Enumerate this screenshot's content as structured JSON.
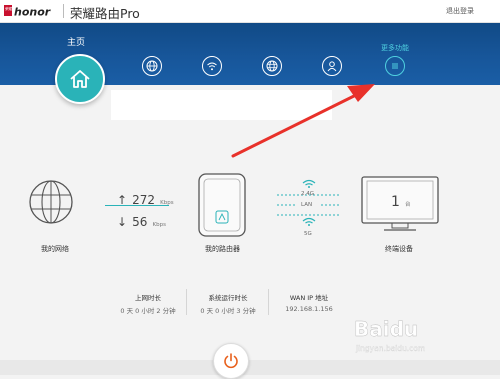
{
  "header": {
    "logo_text": "honor",
    "logo_small": "荣耀",
    "product_name": "荣耀路由Pro",
    "logout": "退出登录"
  },
  "nav": {
    "home_label": "主页",
    "more_label": "更多功能",
    "icons": [
      "home-icon",
      "globe-icon",
      "wifi-icon",
      "network-globe-icon",
      "user-icon",
      "menu-icon"
    ]
  },
  "network": {
    "label": "我的网络",
    "upload_value": "272",
    "upload_unit": "Kbps",
    "download_value": "56",
    "download_unit": "Kbps"
  },
  "router": {
    "label": "我的路由器",
    "band_24": "2.4G",
    "band_lan": "LAN",
    "band_5g": "5G"
  },
  "devices": {
    "label": "终端设备",
    "count": "1",
    "count_unit": "台"
  },
  "info": [
    {
      "title": "上网时长",
      "value": "0 天 0 小时 2 分钟"
    },
    {
      "title": "系统运行时长",
      "value": "0 天 0 小时 3 分钟"
    },
    {
      "title": "WAN IP 地址",
      "value": "192.168.1.156"
    }
  ],
  "watermark": {
    "brand": "Baidu",
    "sub": "jingyan.baidu.com"
  },
  "colors": {
    "nav_band": "#17569a",
    "home_button": "#2ab3b8",
    "accent_teal": "#4fd0e0",
    "arrow_red": "#e8312a",
    "power_orange": "#e8601c"
  }
}
